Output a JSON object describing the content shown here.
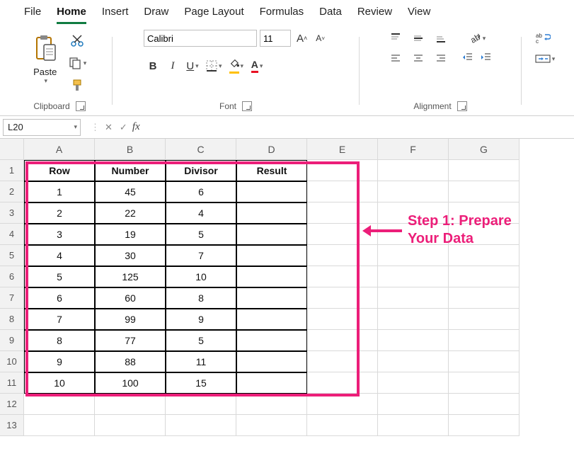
{
  "menu": {
    "tabs": [
      "File",
      "Home",
      "Insert",
      "Draw",
      "Page Layout",
      "Formulas",
      "Data",
      "Review",
      "View"
    ],
    "active": "Home"
  },
  "ribbon": {
    "clipboard": {
      "label": "Clipboard",
      "paste": "Paste"
    },
    "font": {
      "label": "Font",
      "fontName": "Calibri",
      "fontSize": "11",
      "bold": "B",
      "italic": "I",
      "underline": "U",
      "fillLetter": "",
      "fontColorLetter": "A"
    },
    "alignment": {
      "label": "Alignment"
    },
    "wrap": {
      "label": "Wrap"
    }
  },
  "formulaBar": {
    "nameBox": "L20",
    "fx": "fx",
    "value": ""
  },
  "sheet": {
    "cols": [
      "A",
      "B",
      "C",
      "D",
      "E",
      "F",
      "G"
    ],
    "rows": [
      1,
      2,
      3,
      4,
      5,
      6,
      7,
      8,
      9,
      10,
      11,
      12,
      13
    ],
    "headers": [
      "Row",
      "Number",
      "Divisor",
      "Result"
    ],
    "data": [
      [
        1,
        45,
        6,
        ""
      ],
      [
        2,
        22,
        4,
        ""
      ],
      [
        3,
        19,
        5,
        ""
      ],
      [
        4,
        30,
        7,
        ""
      ],
      [
        5,
        125,
        10,
        ""
      ],
      [
        6,
        60,
        8,
        ""
      ],
      [
        7,
        99,
        9,
        ""
      ],
      [
        8,
        77,
        5,
        ""
      ],
      [
        9,
        88,
        11,
        ""
      ],
      [
        10,
        100,
        15,
        ""
      ]
    ]
  },
  "annotation": {
    "text1": "Step 1: Prepare",
    "text2": "Your Data"
  }
}
